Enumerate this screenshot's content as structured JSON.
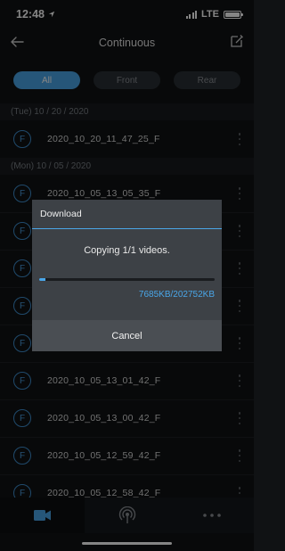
{
  "status": {
    "time": "12:48",
    "network": "LTE"
  },
  "header": {
    "title": "Continuous"
  },
  "filters": [
    "All",
    "Front",
    "Rear"
  ],
  "active_filter": "All",
  "groups": [
    {
      "date": "(Tue) 10 / 20 / 2020",
      "items": [
        {
          "badge": "F",
          "name": "2020_10_20_11_47_25_F"
        }
      ]
    },
    {
      "date": "(Mon) 10 / 05 / 2020",
      "items": [
        {
          "badge": "F",
          "name": "2020_10_05_13_05_35_F"
        },
        {
          "badge": "F",
          "name": ""
        },
        {
          "badge": "F",
          "name": ""
        },
        {
          "badge": "F",
          "name": ""
        },
        {
          "badge": "F",
          "name": ""
        },
        {
          "badge": "F",
          "name": "2020_10_05_13_01_42_F"
        },
        {
          "badge": "F",
          "name": "2020_10_05_13_00_42_F"
        },
        {
          "badge": "F",
          "name": "2020_10_05_12_59_42_F"
        },
        {
          "badge": "F",
          "name": "2020_10_05_12_58_42_F"
        }
      ]
    }
  ],
  "dialog": {
    "title": "Download",
    "message": "Copying 1/1 videos.",
    "progress_fraction": 0.038,
    "current": "7685KB",
    "separator": "/",
    "total": "202752KB",
    "cancel_label": "Cancel"
  },
  "tabs": [
    {
      "icon": "video-camera-icon",
      "active": true
    },
    {
      "icon": "wireless-signal-icon",
      "active": false
    },
    {
      "icon": "more-icon",
      "active": false
    }
  ],
  "colors": {
    "accent": "#4aa6e8",
    "background": "#101214",
    "dialog": "#3d4146"
  }
}
